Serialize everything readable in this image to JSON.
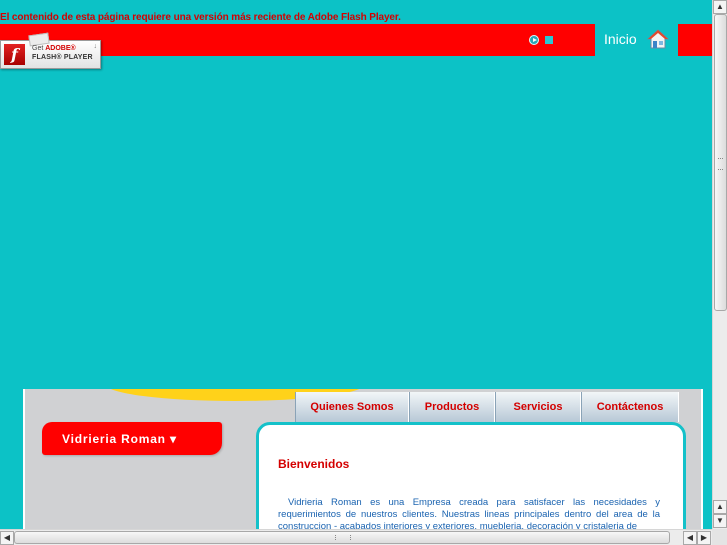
{
  "flash_notice": {
    "message": "El contenido de esta página requiere una versión más reciente de Adobe Flash Player.",
    "badge_get": "Get",
    "badge_adobe": "ADOBE®",
    "badge_product": "FLASH® PLAYER",
    "badge_icon": "flash-icon"
  },
  "header": {
    "home_label": "Inicio",
    "home_icon": "house-icon",
    "play_icon": "play-icon",
    "stop_icon": "stop-icon"
  },
  "nav": {
    "tabs": [
      {
        "label": "Quienes Somos"
      },
      {
        "label": "Productos"
      },
      {
        "label": "Servicios"
      },
      {
        "label": "Contáctenos"
      }
    ]
  },
  "brand": {
    "name": "Vidrieria Roman ▾"
  },
  "content": {
    "title": "Bienvenidos",
    "body": "Vidrieria Roman es una Empresa creada para satisfacer las necesidades y requerimientos de nuestros clientes. Nuestras lineas principales dentro del area de la construccion - acabados interiores y exteriores, muebleria, decoración y cristaleria de"
  },
  "colors": {
    "background": "#0cc2c6",
    "accent_red": "#ff0000",
    "frame_gray": "#d0d1d3",
    "link_red": "#d40000",
    "body_blue": "#1a63b0"
  },
  "scrollbars": {
    "up_arrow": "▲",
    "down_arrow": "▼",
    "left_arrow": "◀",
    "right_arrow": "▶"
  }
}
